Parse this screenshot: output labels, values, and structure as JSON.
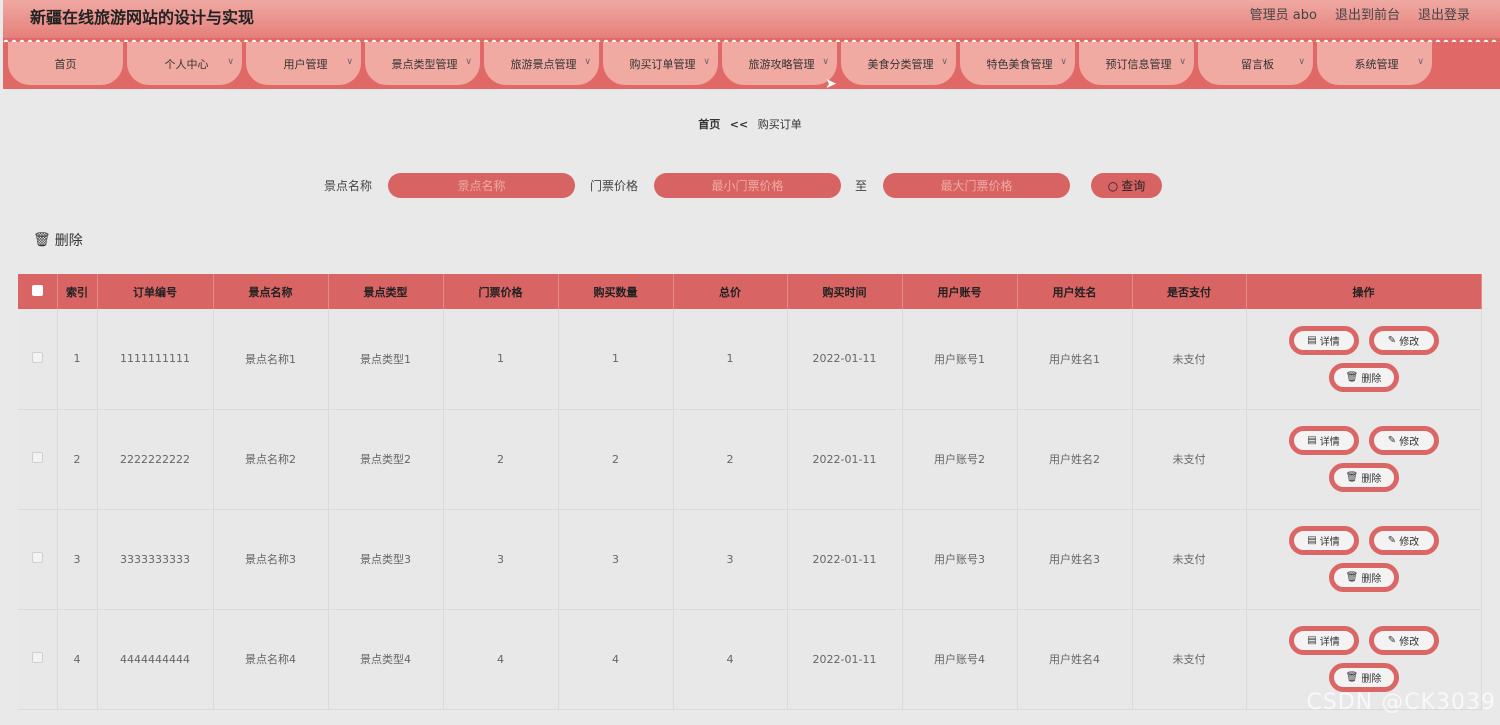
{
  "header": {
    "title": "新疆在线旅游网站的设计与实现",
    "admin": "管理员 abo",
    "exit_front": "退出到前台",
    "logout": "退出登录"
  },
  "nav": [
    {
      "label": "首页",
      "dropdown": false
    },
    {
      "label": "个人中心",
      "dropdown": true
    },
    {
      "label": "用户管理",
      "dropdown": true
    },
    {
      "label": "景点类型管理",
      "dropdown": true
    },
    {
      "label": "旅游景点管理",
      "dropdown": true
    },
    {
      "label": "购买订单管理",
      "dropdown": true
    },
    {
      "label": "旅游攻略管理",
      "dropdown": true
    },
    {
      "label": "美食分类管理",
      "dropdown": true
    },
    {
      "label": "特色美食管理",
      "dropdown": true
    },
    {
      "label": "预订信息管理",
      "dropdown": true
    },
    {
      "label": "留言板",
      "dropdown": true
    },
    {
      "label": "系统管理",
      "dropdown": true
    }
  ],
  "breadcrumb": {
    "home": "首页",
    "sep": "<<",
    "current": "购买订单"
  },
  "search": {
    "name_label": "景点名称",
    "name_placeholder": "景点名称",
    "price_label": "门票价格",
    "min_placeholder": "最小门票价格",
    "to_label": "至",
    "max_placeholder": "最大门票价格",
    "query_label": "查询"
  },
  "toolbar": {
    "delete_label": "删除"
  },
  "table": {
    "headers": [
      "索引",
      "订单编号",
      "景点名称",
      "景点类型",
      "门票价格",
      "购买数量",
      "总价",
      "购买时间",
      "用户账号",
      "用户姓名",
      "是否支付",
      "操作"
    ],
    "rows": [
      [
        "1",
        "1111111111",
        "景点名称1",
        "景点类型1",
        "1",
        "1",
        "1",
        "2022-01-11",
        "用户账号1",
        "用户姓名1",
        "未支付"
      ],
      [
        "2",
        "2222222222",
        "景点名称2",
        "景点类型2",
        "2",
        "2",
        "2",
        "2022-01-11",
        "用户账号2",
        "用户姓名2",
        "未支付"
      ],
      [
        "3",
        "3333333333",
        "景点名称3",
        "景点类型3",
        "3",
        "3",
        "3",
        "2022-01-11",
        "用户账号3",
        "用户姓名3",
        "未支付"
      ],
      [
        "4",
        "4444444444",
        "景点名称4",
        "景点类型4",
        "4",
        "4",
        "4",
        "2022-01-11",
        "用户账号4",
        "用户姓名4",
        "未支付"
      ]
    ],
    "actions": {
      "detail": "详情",
      "edit": "修改",
      "delete": "删除"
    }
  },
  "watermark": "CSDN @CK3039",
  "colors": {
    "accent": "#d86464",
    "nav_bg": "#e06967",
    "nav_item": "#f1aaa2"
  }
}
